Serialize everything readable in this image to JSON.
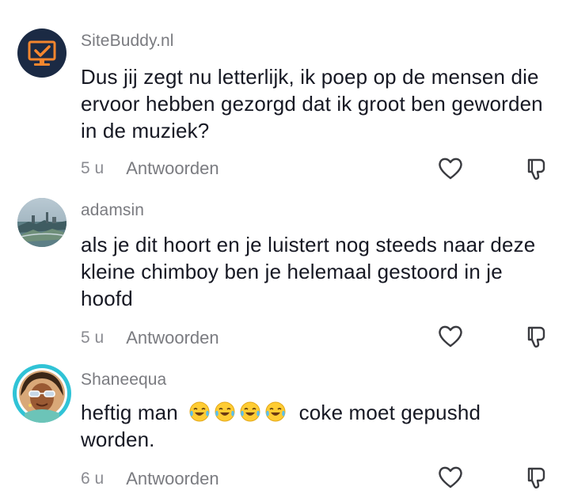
{
  "comments": [
    {
      "username": "SiteBuddy.nl",
      "avatar_icon": "monitor-checkmark-icon",
      "text": "Dus jij zegt nu letterlijk, ik poep op de mensen die ervoor hebben gezorgd dat ik groot ben geworden in de muziek?",
      "time": "5 u",
      "reply_label": "Antwoorden"
    },
    {
      "username": "adamsin",
      "avatar_icon": "city-photo-avatar",
      "text": "als je dit hoort en je luistert nog steeds naar deze kleine chimboy ben je helemaal gestoord in je hoofd",
      "time": "5 u",
      "reply_label": "Antwoorden"
    },
    {
      "username": "Shaneequa",
      "avatar_icon": "illustrated-portrait-avatar",
      "text_before": "heftig man",
      "emojis": [
        "tears-of-joy-emoji",
        "tears-of-joy-emoji",
        "tears-of-joy-emoji",
        "tears-of-joy-emoji"
      ],
      "text_after": "coke moet gepushd worden.",
      "time": "6 u",
      "reply_label": "Antwoorden"
    }
  ],
  "icons": {
    "like": "heart-outline-icon",
    "dislike": "thumbs-down-outline-icon"
  },
  "colors": {
    "username": "#7a7b80",
    "text": "#161823",
    "avatar1_bg": "#1b2a44",
    "avatar1_accent": "#f5862e",
    "story_ring": "#30c3d6"
  }
}
